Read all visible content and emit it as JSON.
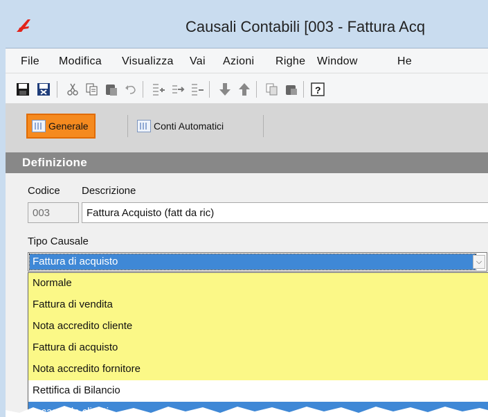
{
  "window": {
    "title": "Causali Contabili [003 - Fattura Acq"
  },
  "menu": [
    {
      "label": "File"
    },
    {
      "label": "Modifica"
    },
    {
      "label": "Visualizza"
    },
    {
      "label": "Vai"
    },
    {
      "label": "Azioni"
    },
    {
      "label": "Righe"
    },
    {
      "label": "Window"
    },
    {
      "label": "He"
    }
  ],
  "toolbar": {
    "icons": [
      "save-icon",
      "save-close-icon",
      "cut-icon",
      "copy-icon",
      "paste-icon",
      "undo-icon",
      "insert-row-icon",
      "append-row-icon",
      "delete-row-icon",
      "move-down-icon",
      "move-up-icon",
      "duplicate-icon",
      "stamp-icon",
      "help-icon"
    ]
  },
  "tabs": [
    {
      "label": "Generale",
      "active": true
    },
    {
      "label": "Conti Automatici",
      "active": false
    }
  ],
  "section": {
    "title": "Definizione"
  },
  "form": {
    "codice_label": "Codice",
    "descrizione_label": "Descrizione",
    "codice_value": "003",
    "descrizione_value": "Fattura Acquisto (fatt da ric)",
    "tipo_causale_label": "Tipo Causale",
    "tipo_causale_value": "Fattura di acquisto"
  },
  "dropdown": {
    "options": [
      {
        "label": "Normale"
      },
      {
        "label": "Fattura di vendita"
      },
      {
        "label": "Nota accredito cliente"
      },
      {
        "label": "Fattura di acquisto"
      },
      {
        "label": "Nota accredito fornitore"
      },
      {
        "label": "Rettifica di Bilancio"
      },
      {
        "label": "Incassi da clienti"
      }
    ]
  },
  "colors": {
    "active_tab": "#f58a1f",
    "highlight": "#fbf887",
    "selection": "#3f88d6",
    "section_header": "#888888"
  }
}
